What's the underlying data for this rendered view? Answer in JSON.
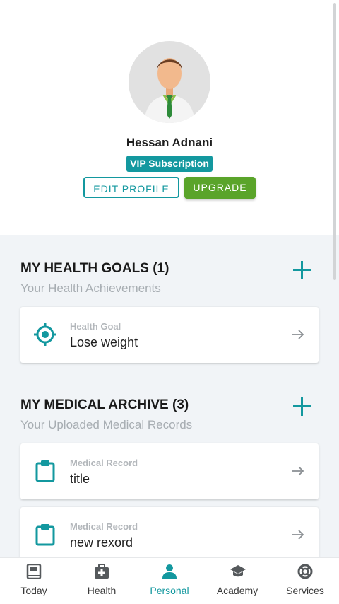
{
  "profile": {
    "name": "Hessan Adnani",
    "subscription": "VIP Subscription",
    "edit_label": "EDIT PROFILE",
    "upgrade_label": "UPGRADE"
  },
  "goals": {
    "title": "MY HEALTH GOALS (1)",
    "subtitle": "Your Health Achievements",
    "items": [
      {
        "label": "Health Goal",
        "value": "Lose weight",
        "icon": "target-icon"
      }
    ]
  },
  "archive": {
    "title": "MY MEDICAL ARCHIVE (3)",
    "subtitle": "Your Uploaded Medical Records",
    "items": [
      {
        "label": "Medical Record",
        "value": "title",
        "icon": "clipboard-icon"
      },
      {
        "label": "Medical Record",
        "value": "new rexord",
        "icon": "clipboard-icon"
      }
    ]
  },
  "nav": {
    "items": [
      {
        "label": "Today",
        "icon": "book-icon"
      },
      {
        "label": "Health",
        "icon": "medical-kit-icon"
      },
      {
        "label": "Personal",
        "icon": "person-icon",
        "active": true
      },
      {
        "label": "Academy",
        "icon": "graduation-cap-icon"
      },
      {
        "label": "Services",
        "icon": "lifebuoy-icon"
      }
    ]
  },
  "colors": {
    "accent": "#13989f",
    "upgrade": "#5aa42a",
    "background": "#f1f4f7"
  }
}
